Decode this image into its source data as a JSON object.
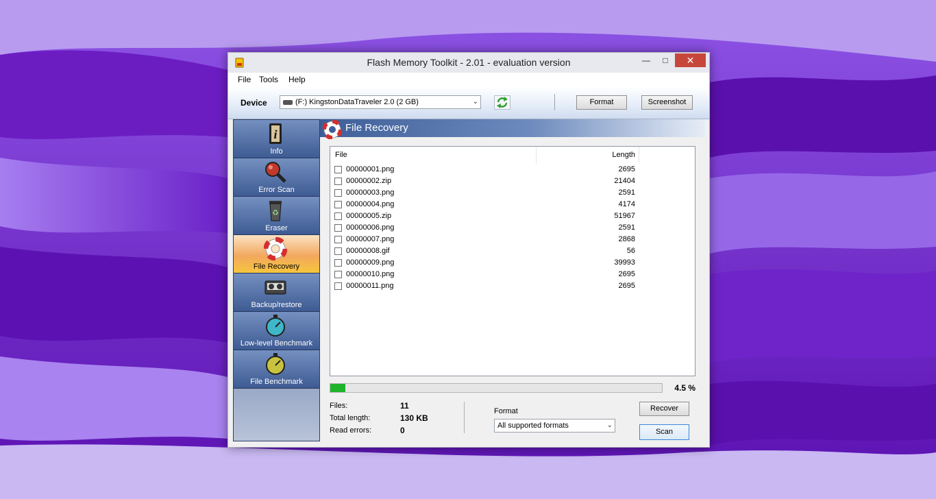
{
  "window": {
    "title": "Flash Memory Toolkit - 2.01 - evaluation version"
  },
  "menu": [
    "File",
    "Tools",
    "Help"
  ],
  "toolbar": {
    "device_label": "Device",
    "device_value": "(F:) KingstonDataTraveler 2.0 (2 GB)",
    "format_label": "Format",
    "screenshot_label": "Screenshot"
  },
  "sidebar": {
    "items": [
      {
        "label": "Info",
        "icon": "info-icon"
      },
      {
        "label": "Error Scan",
        "icon": "magnifier-icon"
      },
      {
        "label": "Eraser",
        "icon": "recycle-bin-icon"
      },
      {
        "label": "File Recovery",
        "icon": "lifebuoy-icon",
        "active": true
      },
      {
        "label": "Backup/restore",
        "icon": "tape-icon"
      },
      {
        "label": "Low-level Benchmark",
        "icon": "stopwatch-icon"
      },
      {
        "label": "File Benchmark",
        "icon": "stopwatch-icon"
      }
    ]
  },
  "panel": {
    "title": "File Recovery",
    "columns": {
      "file": "File",
      "length": "Length"
    },
    "files": [
      {
        "name": "00000001.png",
        "length": "2695"
      },
      {
        "name": "00000002.zip",
        "length": "21404"
      },
      {
        "name": "00000003.png",
        "length": "2591"
      },
      {
        "name": "00000004.png",
        "length": "4174"
      },
      {
        "name": "00000005.zip",
        "length": "51967"
      },
      {
        "name": "00000006.png",
        "length": "2591"
      },
      {
        "name": "00000007.png",
        "length": "2868"
      },
      {
        "name": "00000008.gif",
        "length": "56"
      },
      {
        "name": "00000009.png",
        "length": "39993"
      },
      {
        "name": "00000010.png",
        "length": "2695"
      },
      {
        "name": "00000011.png",
        "length": "2695"
      }
    ],
    "progress": {
      "percent": 4.5,
      "text": "4.5 %"
    },
    "stats": {
      "files_label": "Files:",
      "files_value": "11",
      "total_label": "Total length:",
      "total_value": "130 KB",
      "errors_label": "Read errors:",
      "errors_value": "0"
    },
    "format_label": "Format",
    "format_value": "All supported formats",
    "recover_label": "Recover",
    "scan_label": "Scan"
  },
  "colors": {
    "desktop": "#7a2fd0",
    "sidebar_active": "#f2a85e",
    "progress_fill": "#1fb32a",
    "close_button": "#c7463b"
  }
}
